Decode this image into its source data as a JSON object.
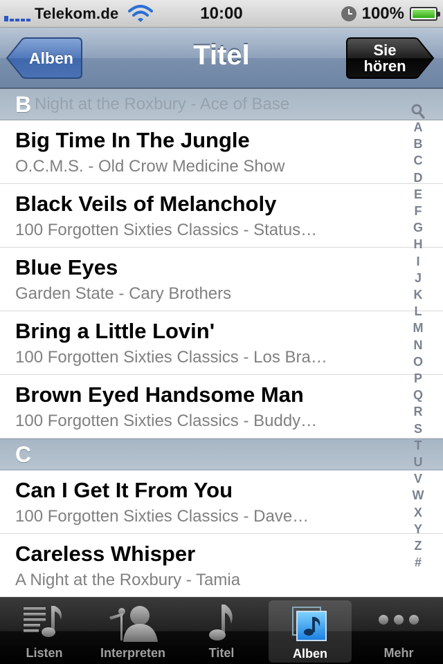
{
  "status": {
    "carrier": "Telekom.de",
    "time": "10:00",
    "battery": "100%",
    "battery_level": 1.0
  },
  "nav": {
    "back_label": "Alben",
    "title": "Titel",
    "now_playing_label_1": "Sie",
    "now_playing_label_2": "hören"
  },
  "sections": [
    {
      "letter": "B",
      "ghost_text": "Night at the Roxbury - Ace of Base",
      "rows": [
        {
          "title": "Big Time In The Jungle",
          "subtitle": "O.C.M.S. - Old Crow Medicine Show"
        },
        {
          "title": "Black Veils of Melancholy",
          "subtitle": "100 Forgotten Sixties Classics - Status…"
        },
        {
          "title": "Blue Eyes",
          "subtitle": "Garden State - Cary Brothers"
        },
        {
          "title": "Bring a Little Lovin'",
          "subtitle": "100 Forgotten Sixties Classics - Los Bra…"
        },
        {
          "title": "Brown Eyed Handsome Man",
          "subtitle": "100 Forgotten Sixties Classics - Buddy…"
        }
      ]
    },
    {
      "letter": "C",
      "rows": [
        {
          "title": "Can I Get It From You",
          "subtitle": "100 Forgotten Sixties Classics - Dave…"
        },
        {
          "title": "Careless Whisper",
          "subtitle": "A Night at the Roxbury - Tamia"
        }
      ]
    }
  ],
  "index": [
    "A",
    "B",
    "C",
    "D",
    "E",
    "F",
    "G",
    "H",
    "I",
    "J",
    "K",
    "L",
    "M",
    "N",
    "O",
    "P",
    "Q",
    "R",
    "S",
    "T",
    "U",
    "V",
    "W",
    "X",
    "Y",
    "Z",
    "#"
  ],
  "tabs": [
    {
      "label": "Listen",
      "icon": "playlist-icon",
      "active": false
    },
    {
      "label": "Interpreten",
      "icon": "artist-icon",
      "active": false
    },
    {
      "label": "Titel",
      "icon": "song-note-icon",
      "active": false
    },
    {
      "label": "Alben",
      "icon": "album-icon",
      "active": true
    },
    {
      "label": "Mehr",
      "icon": "more-dots-icon",
      "active": false
    }
  ]
}
